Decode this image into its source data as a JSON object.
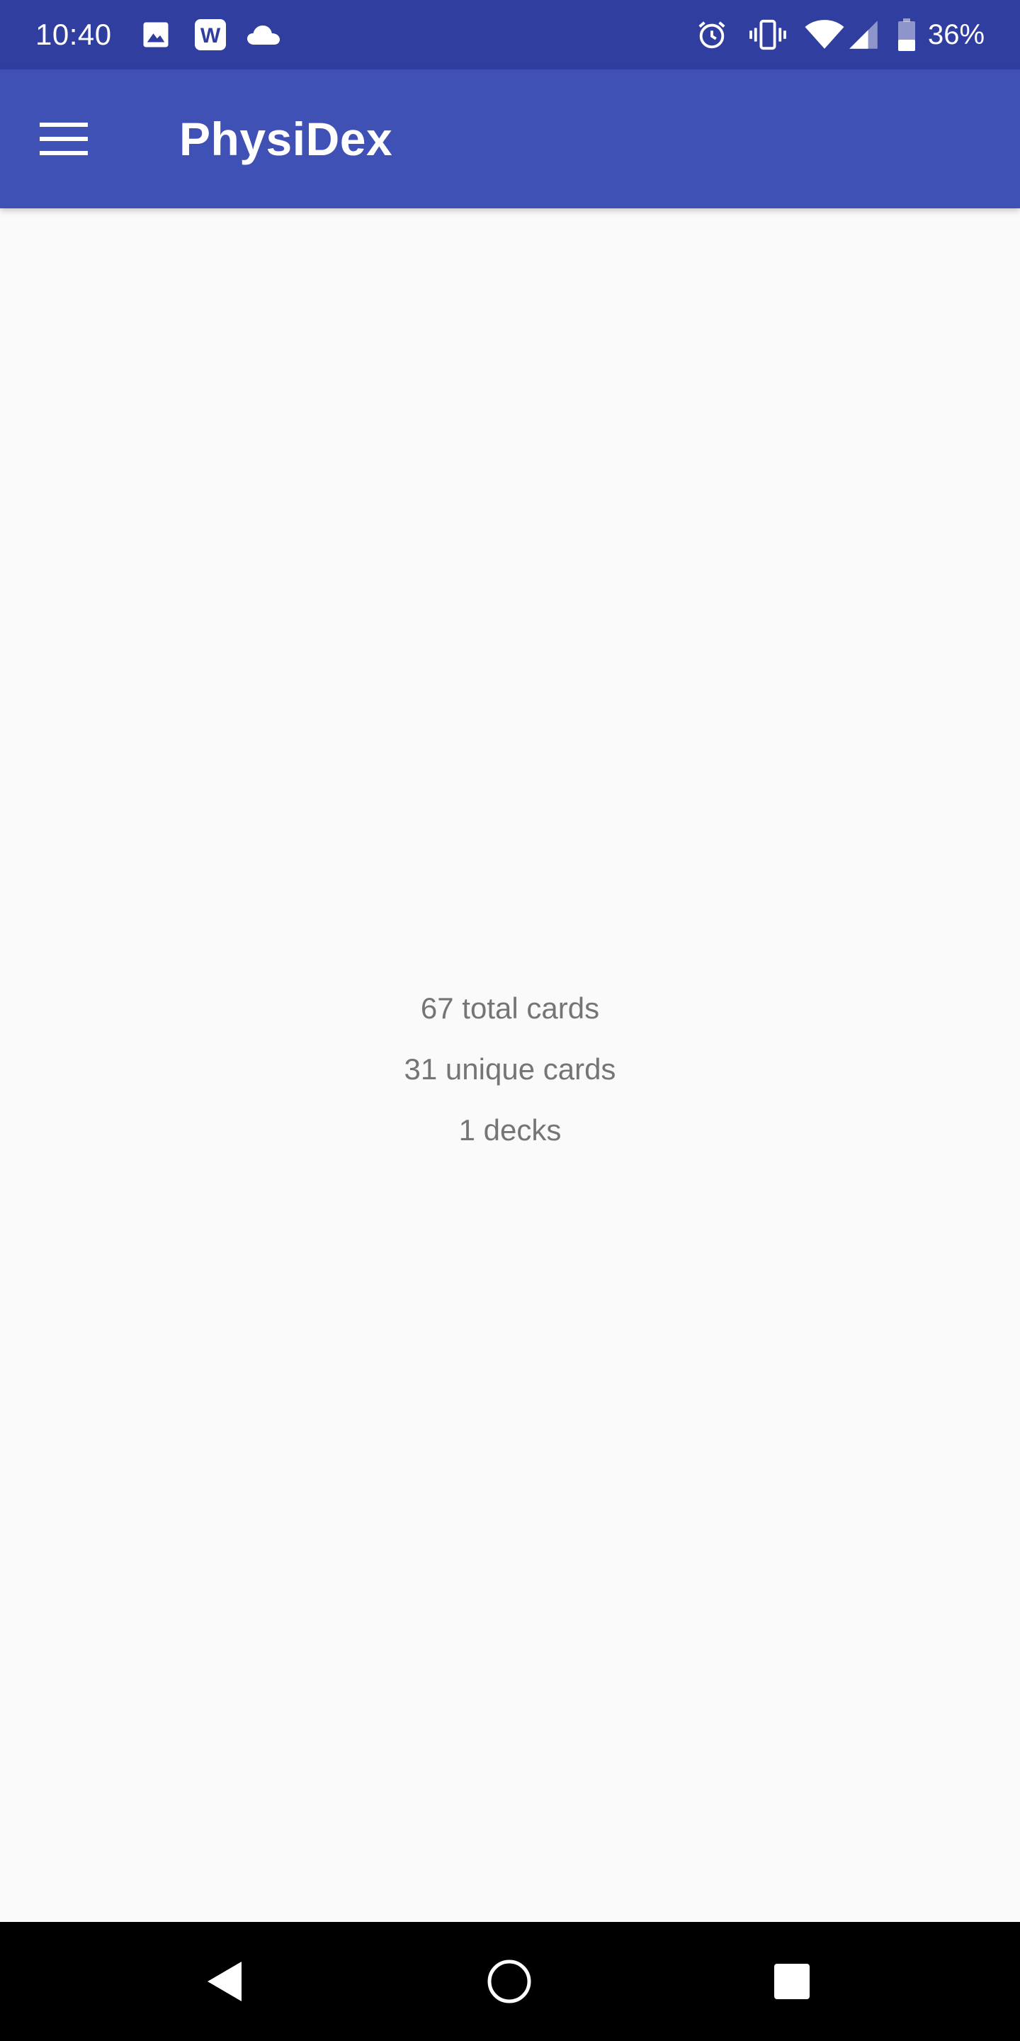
{
  "status_bar": {
    "time": "10:40",
    "battery_percent": "36%",
    "notification_icons": [
      "image-icon",
      "word-icon",
      "cloud-icon"
    ],
    "system_icons": [
      "alarm-icon",
      "vibrate-icon",
      "wifi-icon",
      "signal-icon",
      "battery-icon"
    ],
    "w_glyph": "W"
  },
  "app_bar": {
    "title": "PhysiDex",
    "menu_icon": "hamburger-menu-icon"
  },
  "stats": {
    "total_cards": "67 total cards",
    "unique_cards": "31 unique cards",
    "decks": "1 decks"
  },
  "nav_bar": {
    "buttons": [
      "back-icon",
      "home-icon",
      "recents-icon"
    ]
  },
  "colors": {
    "status_bar": "#303F9F",
    "app_bar": "#3F51B5",
    "background": "#FAFAFA",
    "stat_text": "#757575",
    "nav_bar": "#000000"
  }
}
